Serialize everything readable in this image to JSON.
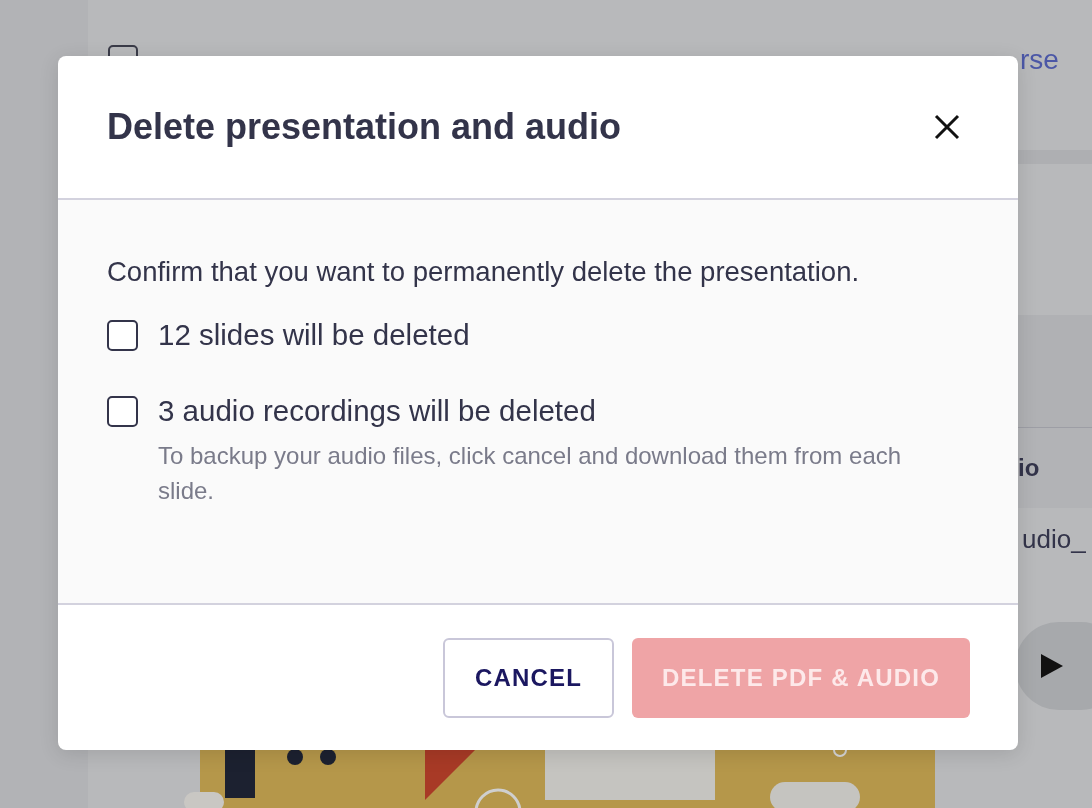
{
  "background": {
    "link_fragment": "rse",
    "column_heading_fragment": "io",
    "cell_fragment": "udio_"
  },
  "dialog": {
    "title": "Delete presentation and audio",
    "message": "Confirm that you want to permanently delete the presentation.",
    "checkboxes": [
      {
        "label": "12 slides will be deleted",
        "checked": false
      },
      {
        "label": "3 audio recordings will be deleted",
        "checked": false,
        "hint": "To backup your audio files, click cancel and download them from each slide."
      }
    ],
    "buttons": [
      {
        "label": "CANCEL",
        "kind": "secondary",
        "disabled": false
      },
      {
        "label": "DELETE PDF & AUDIO",
        "kind": "danger",
        "disabled": true
      }
    ]
  }
}
